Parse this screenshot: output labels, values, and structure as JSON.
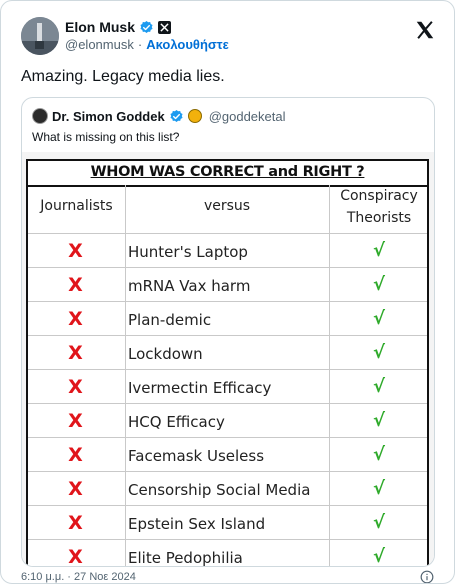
{
  "tweet": {
    "author_name": "Elon Musk",
    "author_handle": "@elonmusk",
    "separator": "·",
    "follow_label": "Ακολουθήστε",
    "text": "Amazing. Legacy media lies.",
    "timestamp": "6:10 μ.μ. · 27 Νοε 2024"
  },
  "quoted": {
    "author_name": "Dr. Simon Goddek",
    "author_handle": "@goddeketal",
    "text": "What is missing on this list?",
    "image": {
      "title": "WHOM WAS CORRECT and RIGHT ?",
      "headers": {
        "left": "Journalists",
        "middle": "versus",
        "right_line1": "Conspiracy",
        "right_line2": "Theorists"
      },
      "rows": [
        {
          "x": "X",
          "label": "Hunter's Laptop",
          "check": "√"
        },
        {
          "x": "X",
          "label": "mRNA Vax harm",
          "check": "√"
        },
        {
          "x": "X",
          "label": "Plan-demic",
          "check": "√"
        },
        {
          "x": "X",
          "label": "Lockdown",
          "check": "√"
        },
        {
          "x": "X",
          "label": "Ivermectin Efficacy",
          "check": "√"
        },
        {
          "x": "X",
          "label": "HCQ Efficacy",
          "check": "√"
        },
        {
          "x": "X",
          "label": "Facemask Useless",
          "check": "√"
        },
        {
          "x": "X",
          "label": "Censorship Social Media",
          "check": "√"
        },
        {
          "x": "X",
          "label": "Epstein Sex Island",
          "check": "√"
        },
        {
          "x": "X",
          "label": "Elite Pedophilia",
          "check": "√"
        }
      ]
    }
  },
  "icons": {
    "verified": "verified-badge-icon",
    "x_logo": "x-logo-icon",
    "info": "info-icon"
  },
  "colors": {
    "accent": "#1d9bf0",
    "follow": "#006fd6",
    "x_mark": "#e0151b",
    "check_mark": "#2faa2b"
  }
}
